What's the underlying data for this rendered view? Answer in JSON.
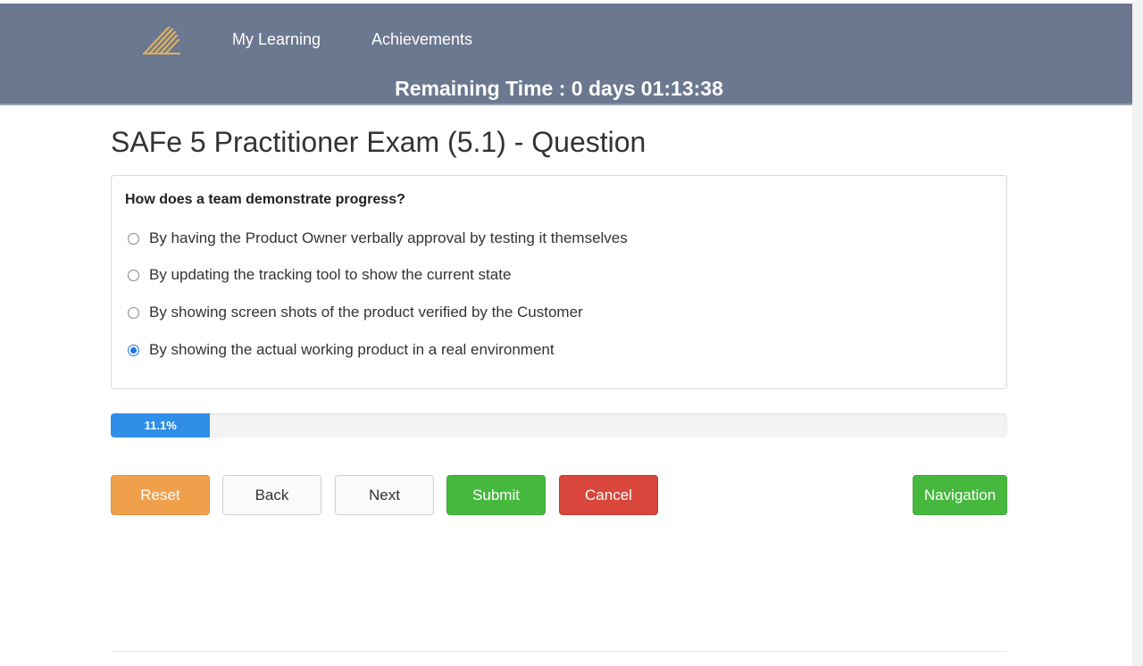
{
  "header": {
    "nav": [
      {
        "label": "My Learning"
      },
      {
        "label": "Achievements"
      }
    ],
    "remaining_time": "Remaining Time : 0 days 01:13:38",
    "colors": {
      "bar": "#6b7890",
      "logo": "#e0b25a"
    }
  },
  "exam": {
    "title": "SAFe 5 Practitioner Exam (5.1) - Question",
    "question": "How does a team demonstrate progress?",
    "options": [
      {
        "label": "By having the Product Owner verbally approval by testing it themselves",
        "selected": false
      },
      {
        "label": "By updating the tracking tool to show the current state",
        "selected": false
      },
      {
        "label": "By showing screen shots of the product verified by the Customer",
        "selected": false
      },
      {
        "label": "By showing the actual working product in a real environment",
        "selected": true
      }
    ]
  },
  "progress": {
    "label": "11.1%",
    "value": 0.111
  },
  "buttons": {
    "reset": "Reset",
    "back": "Back",
    "next": "Next",
    "submit": "Submit",
    "cancel": "Cancel",
    "navigation": "Navigation"
  }
}
